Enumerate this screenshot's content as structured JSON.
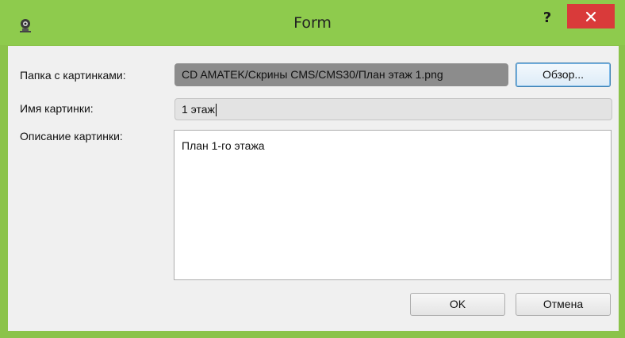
{
  "window": {
    "title": "Form",
    "help_label": "?",
    "colors": {
      "titlebar": "#8ecb4d",
      "close_button": "#d93a3a"
    }
  },
  "form": {
    "folder_label": "Папка с картинками:",
    "folder_value": "CD AMATEK/Скрины CMS/CMS30/План этаж 1.png",
    "browse_label": "Обзор...",
    "name_label": "Имя картинки:",
    "name_value": "1 этаж",
    "description_label": "Описание картинки:",
    "description_value": "План 1-го этажа"
  },
  "buttons": {
    "ok_label": "OK",
    "cancel_label": "Отмена"
  },
  "icons": {
    "app": "webcam-icon",
    "close": "close-icon"
  }
}
